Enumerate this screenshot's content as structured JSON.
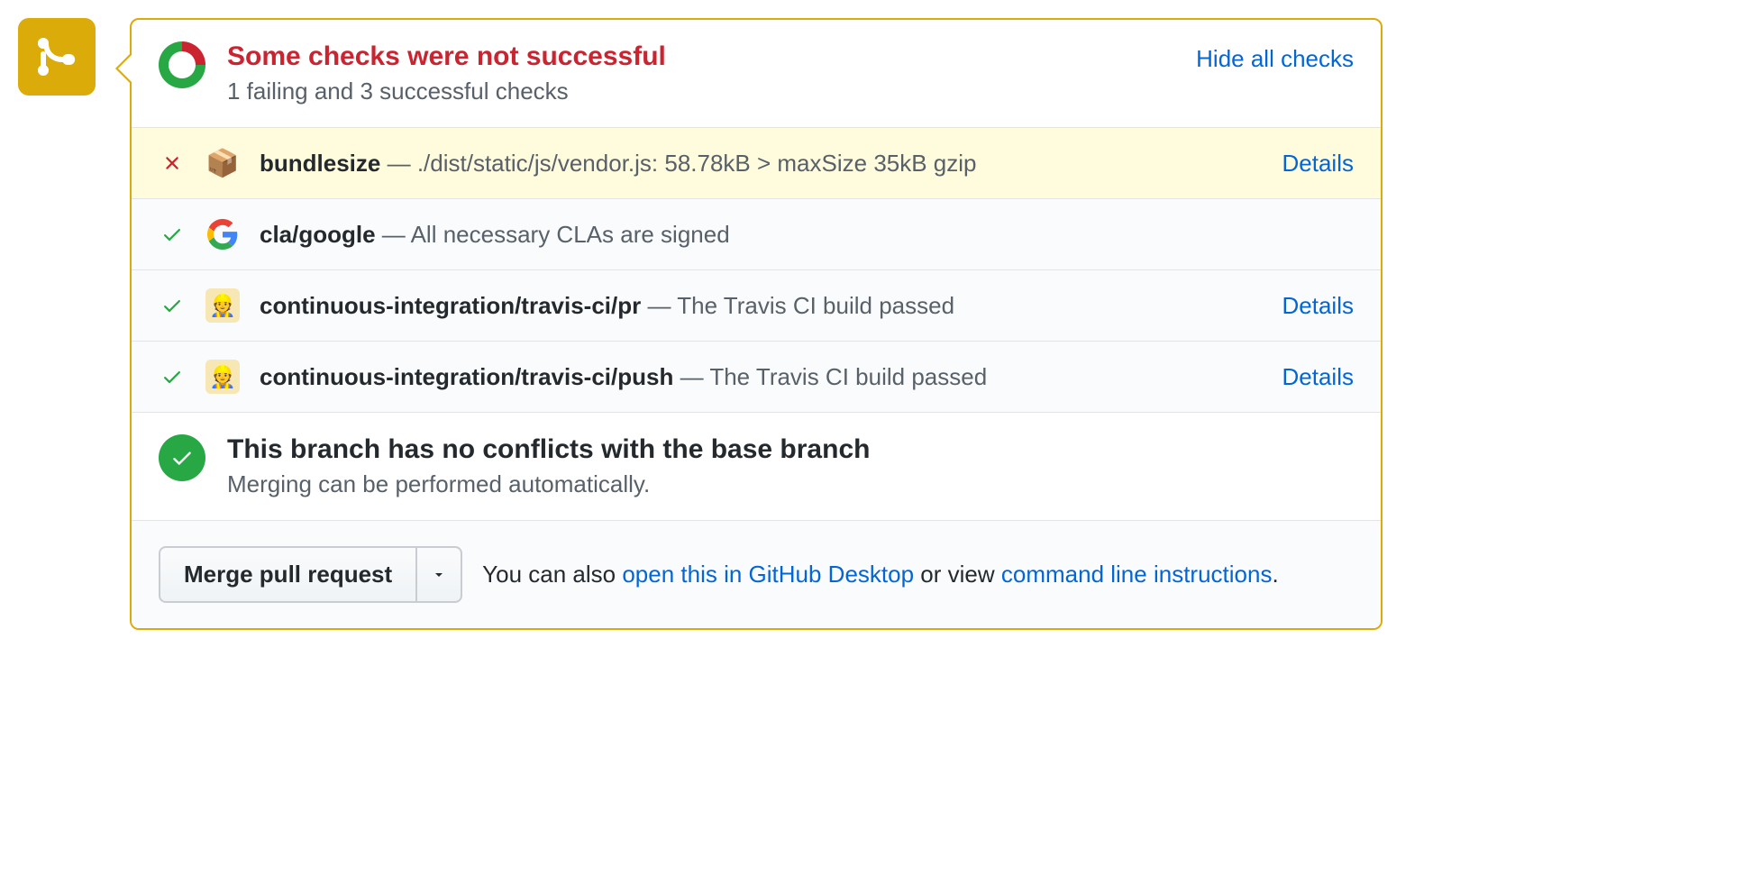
{
  "header": {
    "title": "Some checks were not successful",
    "subtitle": "1 failing and 3 successful checks",
    "hide_link": "Hide all checks"
  },
  "checks": [
    {
      "status": "fail",
      "icon": "package",
      "name": "bundlesize",
      "desc": "./dist/static/js/vendor.js: 58.78kB > maxSize 35kB gzip",
      "details": "Details"
    },
    {
      "status": "pass",
      "icon": "google",
      "name": "cla/google",
      "desc": "All necessary CLAs are signed",
      "details": ""
    },
    {
      "status": "pass",
      "icon": "travis",
      "name": "continuous-integration/travis-ci/pr",
      "desc": "The Travis CI build passed",
      "details": "Details"
    },
    {
      "status": "pass",
      "icon": "travis",
      "name": "continuous-integration/travis-ci/push",
      "desc": "The Travis CI build passed",
      "details": "Details"
    }
  ],
  "merge_status": {
    "title": "This branch has no conflicts with the base branch",
    "subtitle": "Merging can be performed automatically."
  },
  "actions": {
    "merge_button": "Merge pull request",
    "text_before": "You can also ",
    "link1": "open this in GitHub Desktop",
    "text_mid": " or view ",
    "link2": "command line instructions",
    "text_after": "."
  }
}
